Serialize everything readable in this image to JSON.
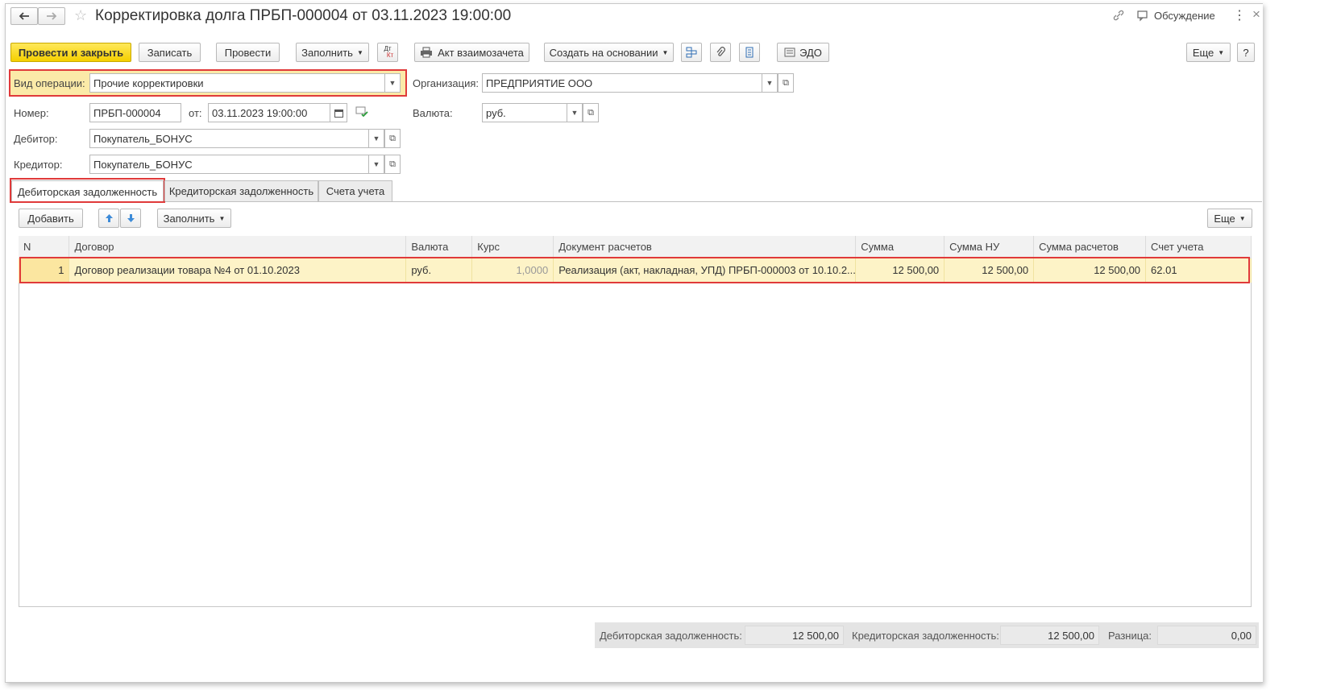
{
  "window": {
    "title": "Корректировка долга ПРБП-000004 от 03.11.2023 19:00:00",
    "discussion_label": "Обсуждение"
  },
  "toolbar": {
    "post_close": "Провести и закрыть",
    "save": "Записать",
    "post": "Провести",
    "fill": "Заполнить",
    "dtkt_top": "Дт",
    "dtkt_bottom": "Кт",
    "act": "Акт взаимозачета",
    "create_based": "Создать на основании",
    "edo": "ЭДО",
    "more": "Еще",
    "help": "?"
  },
  "form": {
    "operation_label": "Вид операции:",
    "operation_value": "Прочие корректировки",
    "org_label": "Организация:",
    "org_value": "ПРЕДПРИЯТИЕ ООО",
    "number_label": "Номер:",
    "number_value": "ПРБП-000004",
    "date_label": "от:",
    "date_value": "03.11.2023 19:00:00",
    "currency_label": "Валюта:",
    "currency_value": "руб.",
    "debtor_label": "Дебитор:",
    "debtor_value": "Покупатель_БОНУС",
    "creditor_label": "Кредитор:",
    "creditor_value": "Покупатель_БОНУС"
  },
  "tabs": [
    {
      "label": "Дебиторская задолженность",
      "active": true
    },
    {
      "label": "Кредиторская задолженность",
      "active": false
    },
    {
      "label": "Счета учета",
      "active": false
    }
  ],
  "table_toolbar": {
    "add": "Добавить",
    "fill": "Заполнить",
    "more": "Еще"
  },
  "table": {
    "columns": [
      "N",
      "Договор",
      "Валюта",
      "Курс",
      "Документ расчетов",
      "Сумма",
      "Сумма НУ",
      "Сумма расчетов",
      "Счет учета"
    ],
    "rows": [
      [
        "1",
        "Договор реализации товара №4 от 01.10.2023",
        "руб.",
        "1,0000",
        "Реализация (акт, накладная, УПД) ПРБП-000003 от 10.10.2...",
        "12 500,00",
        "12 500,00",
        "12 500,00",
        "62.01"
      ]
    ]
  },
  "footer": {
    "debit_label": "Дебиторская задолженность:",
    "debit_value": "12 500,00",
    "credit_label": "Кредиторская задолженность:",
    "credit_value": "12 500,00",
    "diff_label": "Разница:",
    "diff_value": "0,00"
  },
  "colors": {
    "primary_button": "#f5cf00",
    "highlight": "#e03a3a",
    "row_selected": "#fdf3c7"
  }
}
